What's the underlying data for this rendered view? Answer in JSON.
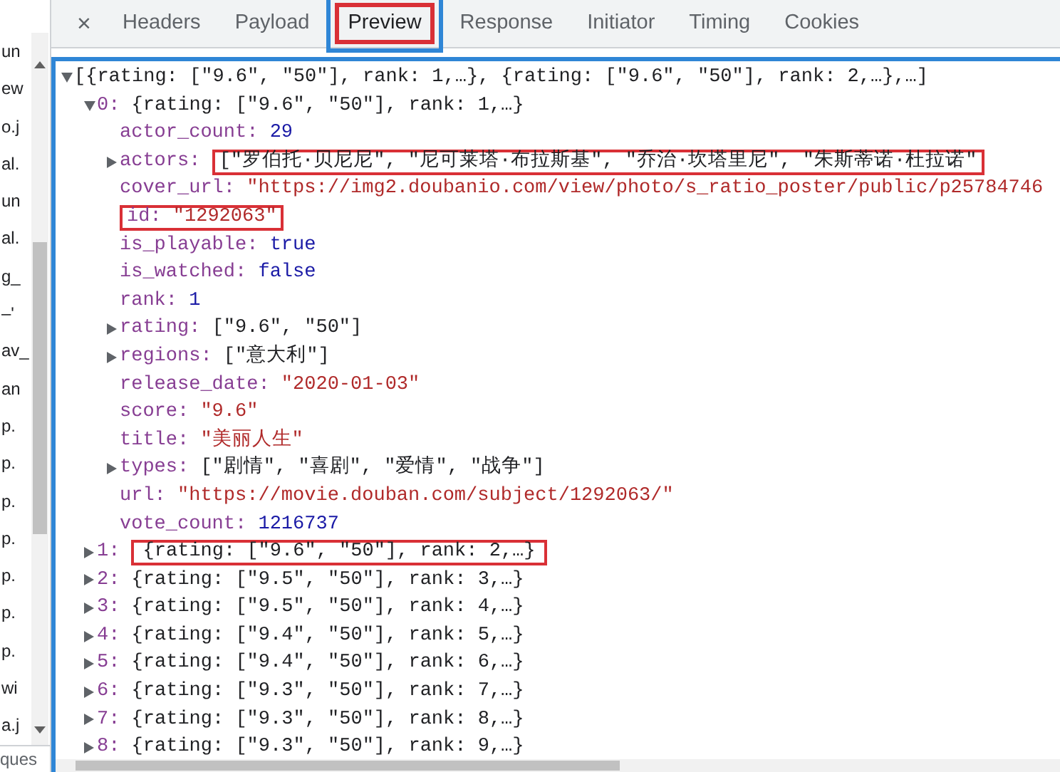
{
  "sidebar": {
    "items": [
      "un",
      "ew",
      "o.j",
      "al.",
      "un",
      "al.",
      "g_",
      "–'",
      "av_",
      "an",
      "p.",
      "p.",
      "p.",
      "p.",
      "p.",
      "p.",
      "p.",
      "wi",
      "a.j"
    ],
    "footer": "ques"
  },
  "close_label": "×",
  "tabs": [
    {
      "label": "Headers",
      "selected": false,
      "highlighted": false
    },
    {
      "label": "Payload",
      "selected": false,
      "highlighted": false
    },
    {
      "label": "Preview",
      "selected": true,
      "highlighted": true
    },
    {
      "label": "Response",
      "selected": false,
      "highlighted": false
    },
    {
      "label": "Initiator",
      "selected": false,
      "highlighted": false
    },
    {
      "label": "Timing",
      "selected": false,
      "highlighted": false
    },
    {
      "label": "Cookies",
      "selected": false,
      "highlighted": false
    }
  ],
  "preview": {
    "tree": {
      "summary": "[{rating: [\"9.6\", \"50\"], rank: 1,…}, {rating: [\"9.6\", \"50\"], rank: 2,…},…]",
      "expanded": true,
      "highlighted": false,
      "children": [
        {
          "key": "0:",
          "summary": "{rating: [\"9.6\", \"50\"], rank: 1,…}",
          "expanded": true,
          "highlighted": false,
          "children": [
            {
              "key": "actor_count:",
              "value": "29",
              "kind": "number",
              "highlighted": false
            },
            {
              "key": "actors:",
              "summary": "[\"罗伯托·贝尼尼\", \"尼可莱塔·布拉斯基\", \"乔治·坎塔里尼\", \"朱斯蒂诺·杜拉诺\"",
              "expanded": false,
              "highlighted": true
            },
            {
              "key": "cover_url:",
              "value": "\"https://img2.doubanio.com/view/photo/s_ratio_poster/public/p25784746",
              "kind": "string",
              "highlighted": false
            },
            {
              "key": "id:",
              "value": "\"1292063\"",
              "kind": "string",
              "highlighted": true
            },
            {
              "key": "is_playable:",
              "value": "true",
              "kind": "boolean",
              "highlighted": false
            },
            {
              "key": "is_watched:",
              "value": "false",
              "kind": "boolean",
              "highlighted": false
            },
            {
              "key": "rank:",
              "value": "1",
              "kind": "number",
              "highlighted": false
            },
            {
              "key": "rating:",
              "summary": "[\"9.6\", \"50\"]",
              "expanded": false,
              "highlighted": false
            },
            {
              "key": "regions:",
              "summary": "[\"意大利\"]",
              "expanded": false,
              "highlighted": false
            },
            {
              "key": "release_date:",
              "value": "\"2020-01-03\"",
              "kind": "string",
              "highlighted": false
            },
            {
              "key": "score:",
              "value": "\"9.6\"",
              "kind": "string",
              "highlighted": false
            },
            {
              "key": "title:",
              "value": "\"美丽人生\"",
              "kind": "string",
              "highlighted": false
            },
            {
              "key": "types:",
              "summary": "[\"剧情\", \"喜剧\", \"爱情\", \"战争\"]",
              "expanded": false,
              "highlighted": false
            },
            {
              "key": "url:",
              "value": "\"https://movie.douban.com/subject/1292063/\"",
              "kind": "string",
              "highlighted": false
            },
            {
              "key": "vote_count:",
              "value": "1216737",
              "kind": "number",
              "highlighted": false
            }
          ]
        },
        {
          "key": "1:",
          "summary": "{rating: [\"9.6\", \"50\"], rank: 2,…}",
          "expanded": false,
          "highlighted": true
        },
        {
          "key": "2:",
          "summary": "{rating: [\"9.5\", \"50\"], rank: 3,…}",
          "expanded": false,
          "highlighted": false
        },
        {
          "key": "3:",
          "summary": "{rating: [\"9.5\", \"50\"], rank: 4,…}",
          "expanded": false,
          "highlighted": false
        },
        {
          "key": "4:",
          "summary": "{rating: [\"9.4\", \"50\"], rank: 5,…}",
          "expanded": false,
          "highlighted": false
        },
        {
          "key": "5:",
          "summary": "{rating: [\"9.4\", \"50\"], rank: 6,…}",
          "expanded": false,
          "highlighted": false
        },
        {
          "key": "6:",
          "summary": "{rating: [\"9.3\", \"50\"], rank: 7,…}",
          "expanded": false,
          "highlighted": false
        },
        {
          "key": "7:",
          "summary": "{rating: [\"9.3\", \"50\"], rank: 8,…}",
          "expanded": false,
          "highlighted": false
        },
        {
          "key": "8:",
          "summary": "{rating: [\"9.3\", \"50\"], rank: 9,…}",
          "expanded": false,
          "highlighted": false
        }
      ]
    }
  }
}
